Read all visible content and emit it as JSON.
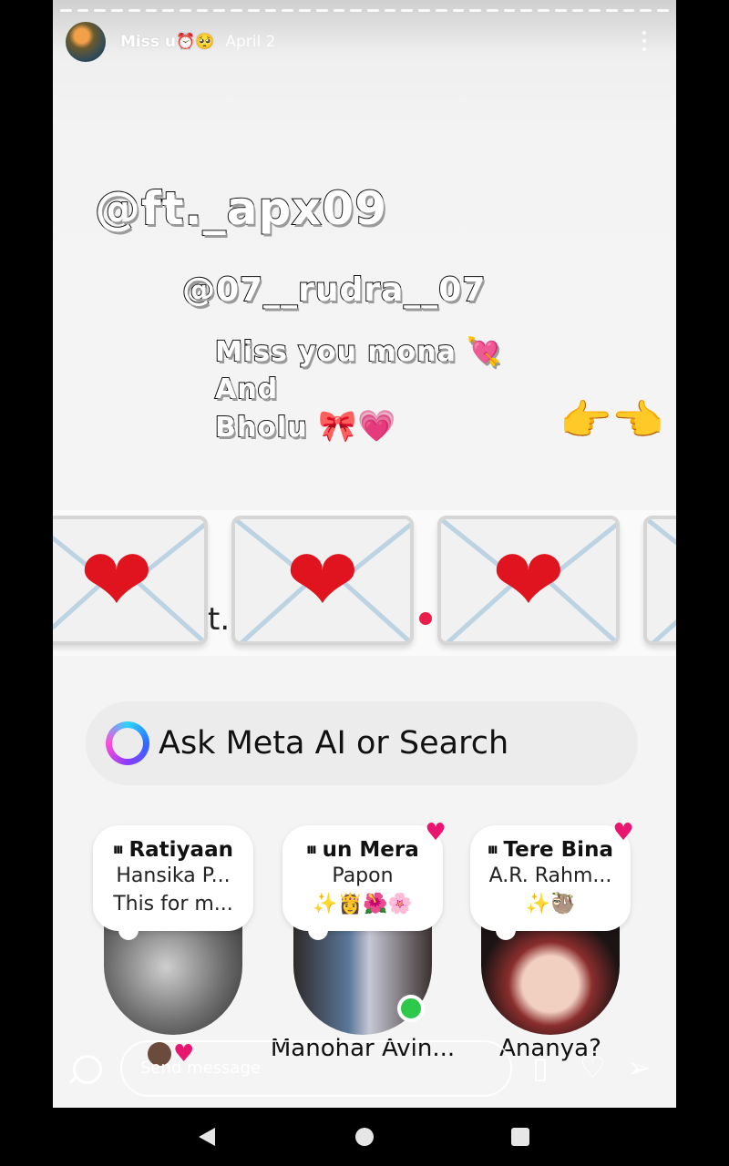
{
  "story": {
    "user": "Miss u⏰🥺",
    "date": "April 2",
    "handle_1": "@ft._apx09",
    "handle_2": "@07__rudra__07",
    "message_line_1": "Miss you mona 💘",
    "message_line_2": "And",
    "message_line_3": "Bholu",
    "message_line_3_emoji": "🎀💗",
    "hands_emoji": "👉👈",
    "envelope_peek_text": "t."
  },
  "search": {
    "placeholder": "Ask Meta AI or Search"
  },
  "friends": [
    {
      "song": "Ratiyaan",
      "line2": "Hansika P...",
      "line3": "This for m...",
      "name": "",
      "liked": false,
      "online": false
    },
    {
      "song": "un Mera",
      "line2": "Papon",
      "line3": "✨👸🌺🌸",
      "name": "Manohar Avin...",
      "liked": true,
      "online": true
    },
    {
      "song": "Tere Bina",
      "line2": "A.R. Rahm...",
      "line3": "✨🦥",
      "name": "Ananya?",
      "liked": true,
      "online": false
    }
  ],
  "reply": {
    "placeholder": "Send message"
  },
  "icons": {
    "camera": "camera-icon",
    "more": "more-vertical-icon",
    "sticker": "sticker-icon",
    "like": "heart-icon",
    "share": "send-icon"
  },
  "colors": {
    "like_pink": "#e8166f",
    "online_green": "#2ec84b",
    "heart_red": "#e0141e"
  }
}
